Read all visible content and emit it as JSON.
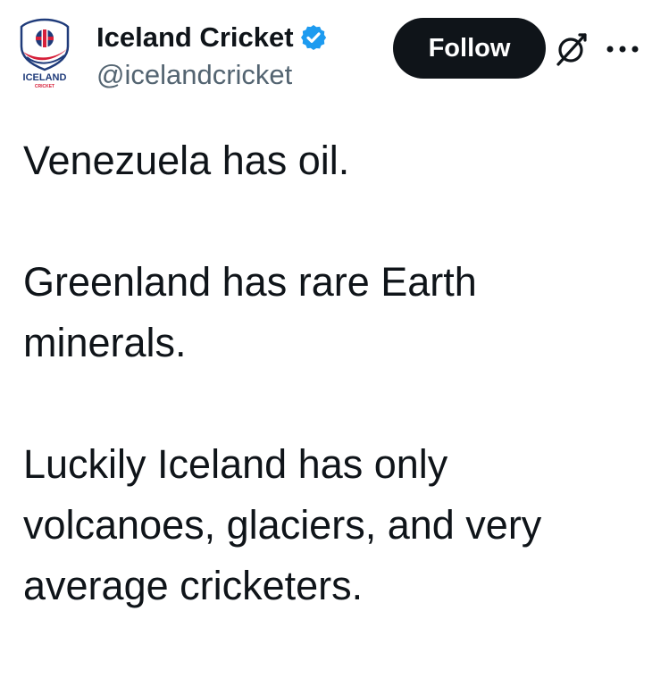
{
  "account": {
    "display_name": "Iceland Cricket",
    "handle": "@icelandcricket",
    "verified": true,
    "avatar_logo_text": "ICELAND",
    "avatar_logo_subtext": "CRICKET"
  },
  "actions": {
    "follow_label": "Follow",
    "grok_icon": "grok-icon",
    "more_icon": "more-options-icon"
  },
  "tweet": {
    "paragraphs": [
      "Venezuela has oil.",
      "Greenland has rare Earth minerals.",
      "Luckily Iceland has only volcanoes, glaciers, and very average cricketers."
    ]
  },
  "colors": {
    "text_primary": "#0f1419",
    "text_secondary": "#536471",
    "verified_blue": "#1d9bf0",
    "follow_bg": "#0f1419",
    "follow_text": "#ffffff",
    "logo_blue": "#1f3b7a",
    "logo_red": "#d6203a"
  }
}
